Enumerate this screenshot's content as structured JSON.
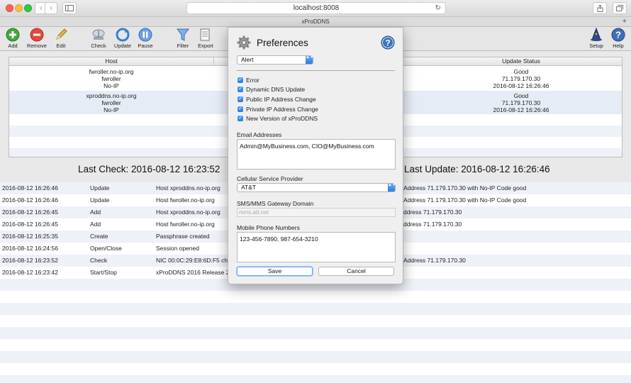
{
  "browser": {
    "url": "localhost:8008",
    "tab_title": "xProDDNS",
    "back_glyph": "‹",
    "forward_glyph": "›",
    "reload_glyph": "↻",
    "newtab_glyph": "+"
  },
  "toolbar": {
    "add": "Add",
    "remove": "Remove",
    "edit": "Edit",
    "check": "Check",
    "update": "Update",
    "pause": "Pause",
    "filter": "Filter",
    "export": "Export",
    "setup": "Setup",
    "help": "Help"
  },
  "host_table": {
    "col_host": "Host",
    "col_status": "Update Status",
    "rows": [
      {
        "host": "fwroller.no-ip.org",
        "user": "fwroller",
        "service": "No-IP",
        "status": "Good",
        "ip": "71.179.170.30",
        "time": "2016-08-12 16:26:46"
      },
      {
        "host": "xproddns.no-ip.org",
        "user": "fwroller",
        "service": "No-IP",
        "status": "Good",
        "ip": "71.179.170.30",
        "time": "2016-08-12 16:26:46"
      }
    ]
  },
  "summary": {
    "last_check": "Last Check: 2016-08-12 16:23:52",
    "last_update": "Last Update: 2016-08-12 16:26:46"
  },
  "log": [
    {
      "time": "2016-08-12 16:26:46",
      "type": "Update",
      "msg": "Host xproddns.no-ip.org",
      "tail": "Address 71.179.170.30 with No-IP Code good"
    },
    {
      "time": "2016-08-12 16:26:46",
      "type": "Update",
      "msg": "Host fwroller.no-ip.org",
      "tail": "Address 71.179.170.30 with No-IP Code good"
    },
    {
      "time": "2016-08-12 16:26:45",
      "type": "Add",
      "msg": "Host xproddns.no-ip.org",
      "tail": "ddress 71.179.170.30"
    },
    {
      "time": "2016-08-12 16:26:45",
      "type": "Add",
      "msg": "Host fwroller.no-ip.org",
      "tail": "ddress 71.179.170.30"
    },
    {
      "time": "2016-08-12 16:25:35",
      "type": "Create",
      "msg": "Passphrase created",
      "tail": ""
    },
    {
      "time": "2016-08-12 16:24:56",
      "type": "Open/Close",
      "msg": "Session opened",
      "tail": ""
    },
    {
      "time": "2016-08-12 16:23:52",
      "type": "Check",
      "msg": "NIC 00:0C:29:E8:6D:F5 ch",
      "tail": "Address 71.179.170.30"
    },
    {
      "time": "2016-08-12 16:23:42",
      "type": "Start/Stop",
      "msg": "xProDDNS 2016 Release 2",
      "tail": ""
    }
  ],
  "prefs": {
    "title": "Preferences",
    "category": "Alert",
    "checkboxes": [
      {
        "label": "Error",
        "checked": true
      },
      {
        "label": "Dynamic DNS Update",
        "checked": true
      },
      {
        "label": "Public IP Address Change",
        "checked": true
      },
      {
        "label": "Private IP Address Change",
        "checked": true
      },
      {
        "label": "New Version of xProDDNS",
        "checked": true
      }
    ],
    "email_label": "Email Addresses",
    "email_value": "Admin@MyBusiness.com, CIO@MyBusiness.com",
    "carrier_label": "Cellular Service Provider",
    "carrier_value": "AT&T",
    "sms_label": "SMS/MMS Gateway Domain",
    "sms_value": "mms.att.net",
    "phone_label": "Mobile Phone Numbers",
    "phone_value": "123-456-7890, 987-654-3210",
    "save": "Save",
    "cancel": "Cancel",
    "check_glyph": "✓",
    "select_arrows": "▲▼"
  }
}
